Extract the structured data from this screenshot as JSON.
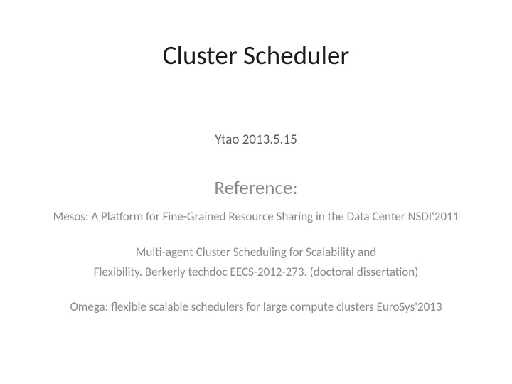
{
  "title": "Cluster Scheduler",
  "author_date": "Ytao 2013.5.15",
  "reference_heading": "Reference:",
  "references": {
    "ref1": "Mesos: A Platform for Fine-Grained Resource Sharing in the Data Center NSDI'2011",
    "ref2_line1": "Multi-agent Cluster Scheduling for Scalability and",
    "ref2_line2": "Flexibility. Berkerly techdoc EECS-2012-273. (doctoral dissertation)",
    "ref3": "Omega: flexible scalable schedulers for large compute clusters EuroSys'2013"
  }
}
